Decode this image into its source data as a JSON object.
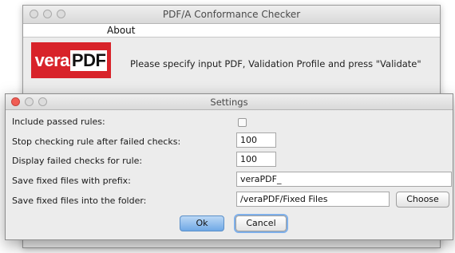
{
  "main_window": {
    "title": "PDF/A Conformance Checker",
    "menu": {
      "about": "About"
    },
    "logo": {
      "prefix": "vera",
      "suffix": "PDF"
    },
    "instruction": "Please specify input PDF, Validation Profile and press \"Validate\""
  },
  "settings": {
    "title": "Settings",
    "include_passed_rules": {
      "label": "Include passed rules:",
      "checked": false
    },
    "stop_checking": {
      "label": "Stop checking rule after failed checks:",
      "value": "100"
    },
    "display_failed": {
      "label": "Display failed checks for rule:",
      "value": "100"
    },
    "prefix": {
      "label": "Save fixed files with prefix:",
      "value": "veraPDF_"
    },
    "folder": {
      "label": "Save fixed files into the folder:",
      "value": "/veraPDF/Fixed Files",
      "choose_label": "Choose"
    },
    "buttons": {
      "ok": "Ok",
      "cancel": "Cancel"
    }
  }
}
